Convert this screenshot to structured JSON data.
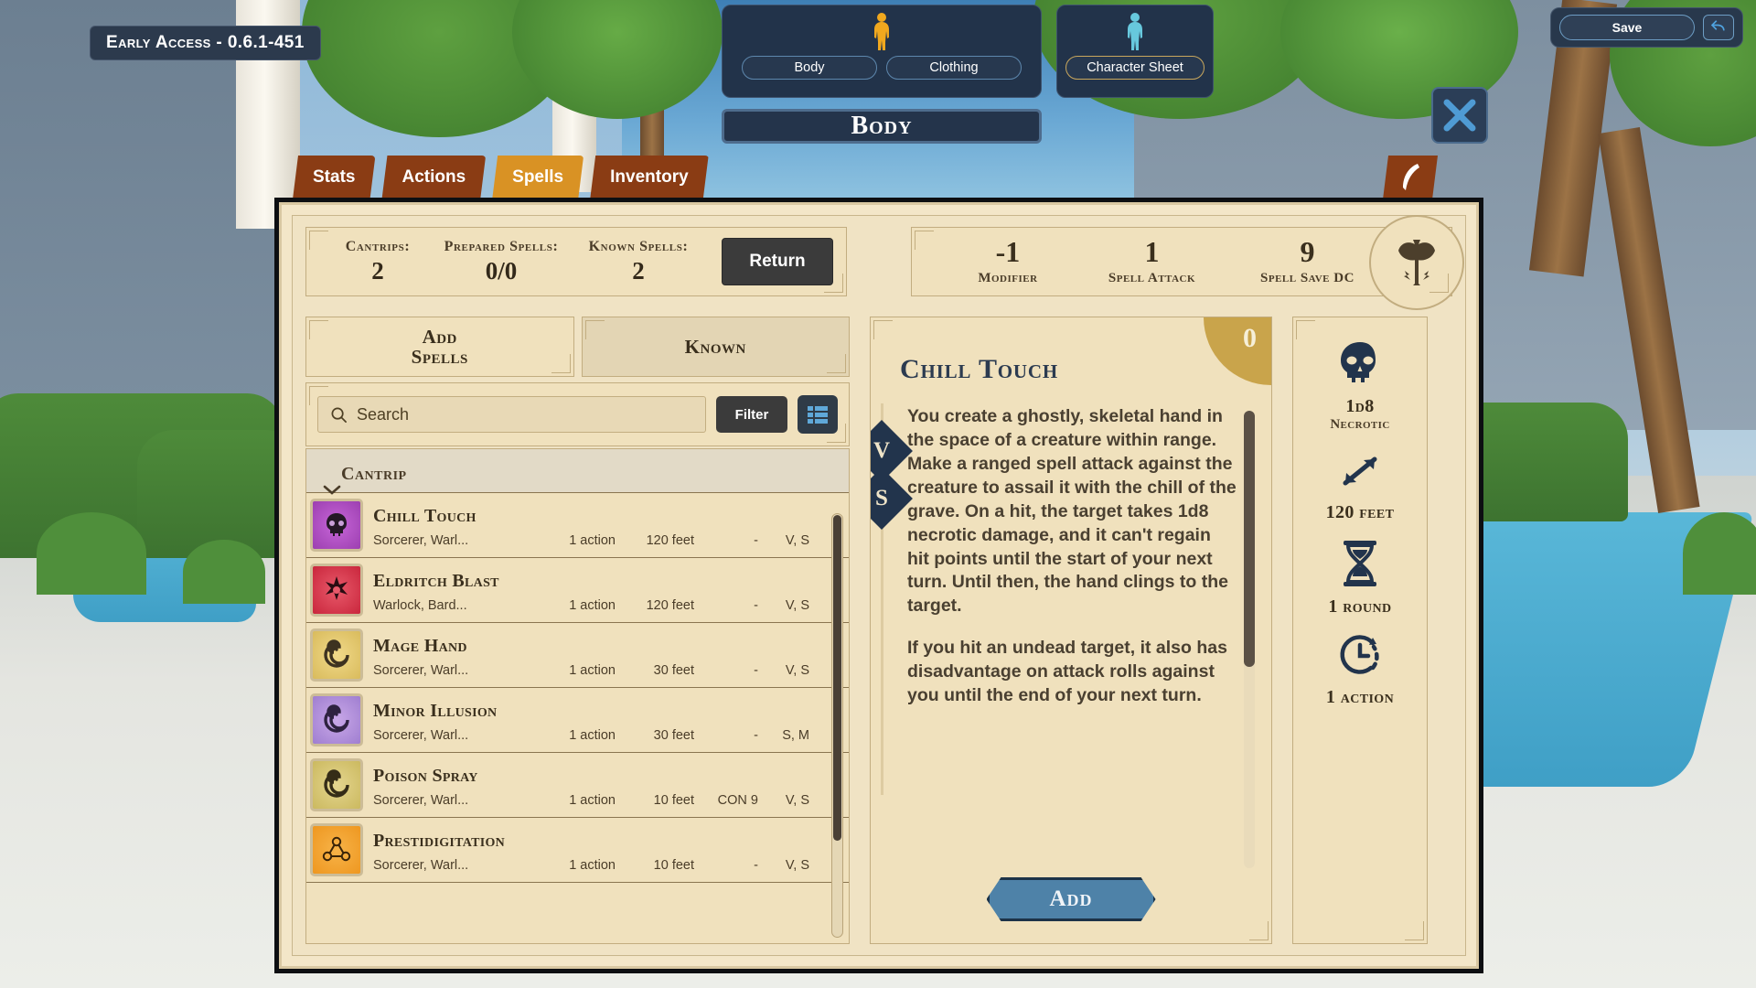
{
  "hud": {
    "early_access": "Early Access - 0.6.1-451",
    "save_label": "Save",
    "undo_icon": "undo-arrow-icon",
    "close_icon": "close-x-icon"
  },
  "top_nav": {
    "appearance_panel": {
      "figure_icon": "body-figure-icon",
      "tabs": [
        {
          "label": "Body",
          "selected": true
        },
        {
          "label": "Clothing",
          "selected": false
        }
      ]
    },
    "character_panel": {
      "figure_icon": "character-figure-icon",
      "tab": {
        "label": "Character Sheet",
        "selected": true
      }
    },
    "banner_title": "Body"
  },
  "category_tabs": [
    {
      "label": "Stats",
      "active": false
    },
    {
      "label": "Actions",
      "active": false
    },
    {
      "label": "Spells",
      "active": true
    },
    {
      "label": "Inventory",
      "active": false
    }
  ],
  "quill_tab_icon": "quill-feather-icon",
  "summary": {
    "cells": [
      {
        "label": "Cantrips:",
        "value": "2"
      },
      {
        "label": "Prepared Spells:",
        "value": "0/0"
      },
      {
        "label": "Known Spells:",
        "value": "2"
      }
    ],
    "return_label": "Return"
  },
  "stats": {
    "cells": [
      {
        "value": "-1",
        "label": "Modifier"
      },
      {
        "value": "1",
        "label": "Spell Attack"
      },
      {
        "value": "9",
        "label": "Spell Save DC"
      }
    ],
    "class_icon": "barbarian-axe-icon"
  },
  "left_panel": {
    "segments": [
      {
        "label": "Add\nSpells",
        "line1": "Add",
        "line2": "Spells",
        "selected": false
      },
      {
        "label": "Known",
        "line1": "Known",
        "line2": "",
        "selected": true
      }
    ],
    "search": {
      "placeholder": "Search",
      "value": "",
      "icon": "search-icon"
    },
    "filter_label": "Filter",
    "listview_icon": "list-view-icon",
    "group": {
      "label": "Cantrip",
      "collapse_icon": "chevron-down-icon"
    },
    "spells": [
      {
        "name": "Chill Touch",
        "classes": "Sorcerer, Warl...",
        "time": "1 action",
        "range": "120 feet",
        "save": "-",
        "components": "V, S",
        "icon": "skull-purple-icon",
        "selected": true
      },
      {
        "name": "Eldritch Blast",
        "classes": "Warlock, Bard...",
        "time": "1 action",
        "range": "120 feet",
        "save": "-",
        "components": "V, S",
        "icon": "starburst-red-icon",
        "selected": false
      },
      {
        "name": "Mage Hand",
        "classes": "Sorcerer, Warl...",
        "time": "1 action",
        "range": "30 feet",
        "save": "-",
        "components": "V, S",
        "icon": "spiral-yellow-icon",
        "selected": false
      },
      {
        "name": "Minor Illusion",
        "classes": "Sorcerer, Warl...",
        "time": "1 action",
        "range": "30 feet",
        "save": "-",
        "components": "S, M",
        "icon": "swirl-violet-icon",
        "selected": false
      },
      {
        "name": "Poison Spray",
        "classes": "Sorcerer, Warl...",
        "time": "1 action",
        "range": "10 feet",
        "save": "CON 9",
        "components": "V, S",
        "icon": "spiral-olive-icon",
        "selected": false
      },
      {
        "name": "Prestidigitation",
        "classes": "Sorcerer, Warl...",
        "time": "1 action",
        "range": "10 feet",
        "save": "-",
        "components": "V, S",
        "icon": "triangle-orange-icon",
        "selected": false
      }
    ]
  },
  "detail": {
    "level": "0",
    "title": "Chill Touch",
    "components": [
      "V",
      "S"
    ],
    "paragraphs": [
      "You create a ghostly, skeletal hand in the space of a creature within range. Make a ranged spell attack against the creature to assail it with the chill of the grave. On a hit, the target takes 1d8 necrotic damage, and it can't regain hit points until the start of your next turn. Until then, the hand clings to the target.",
      "If you hit an undead target, it also has disadvantage on attack rolls against you until the end of your next turn."
    ],
    "add_label": "Add"
  },
  "props": [
    {
      "icon": "skull-icon",
      "value": "1d8",
      "sub": "Necrotic"
    },
    {
      "icon": "range-arrow-icon",
      "value": "120 feet",
      "sub": ""
    },
    {
      "icon": "hourglass-icon",
      "value": "1 round",
      "sub": ""
    },
    {
      "icon": "clock-icon",
      "value": "1 action",
      "sub": ""
    }
  ],
  "colors": {
    "parchment": "#f0e3c4",
    "accent_gold": "#d99224",
    "tab_brown": "#8a3c14",
    "navy": "#22334a",
    "level_badge": "#c9a44b"
  }
}
